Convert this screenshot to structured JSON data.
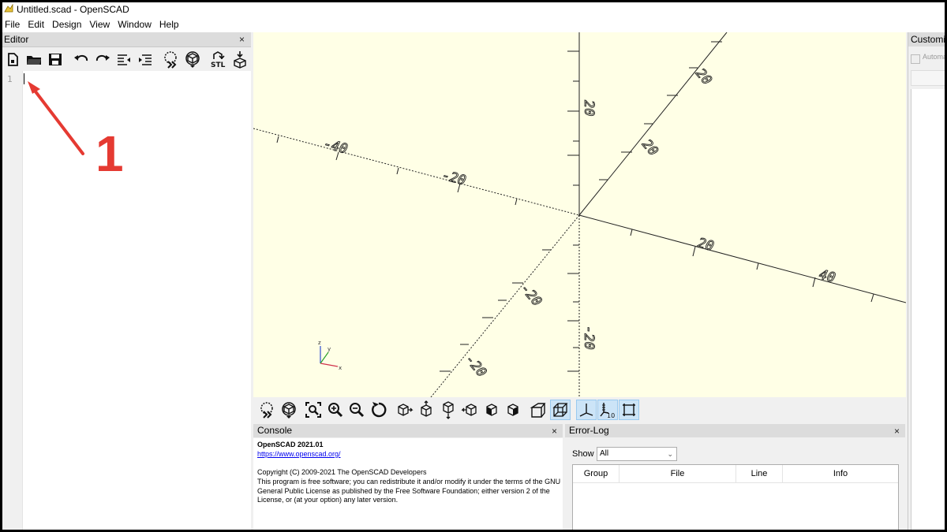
{
  "window": {
    "title": "Untitled.scad - OpenSCAD",
    "icon": "openscad-logo-icon"
  },
  "menu": [
    "File",
    "Edit",
    "Design",
    "View",
    "Window",
    "Help"
  ],
  "editor": {
    "title": "Editor",
    "close": "×",
    "line_number": "1",
    "toolbar_icons": [
      "new-file-icon",
      "open-folder-icon",
      "save-icon",
      "undo-icon",
      "redo-icon",
      "unindent-icon",
      "indent-icon",
      "preview-icon",
      "render-icon",
      "export-stl-icon",
      "send-to-print-icon"
    ],
    "stl_label": "STL"
  },
  "annotation": {
    "number": "1",
    "color": "#e53a32"
  },
  "viewport": {
    "background": "#ffffe6",
    "axis_labels": [
      "-40",
      "-20",
      "20",
      "40",
      "20",
      "-20",
      "20",
      "-20",
      "-20",
      "20"
    ],
    "axes_gizmo": {
      "x": "x",
      "y": "y",
      "z": "z"
    }
  },
  "view_toolbar": {
    "icons": [
      "preview-icon",
      "render-icon",
      "view-all-icon",
      "zoom-in-icon",
      "zoom-out-icon",
      "reset-view-icon",
      "right-view-icon",
      "top-view-icon",
      "bottom-view-icon",
      "left-view-icon",
      "front-view-icon",
      "back-view-icon",
      "perspective-icon",
      "orthogonal-icon",
      "show-axes-icon",
      "show-scale-markers-icon",
      "show-edges-icon"
    ],
    "active": [
      "orthogonal-icon",
      "show-axes-icon",
      "show-scale-markers-icon",
      "show-edges-icon"
    ],
    "scale_label": "10"
  },
  "console": {
    "title": "Console",
    "close": "×",
    "version": "OpenSCAD 2021.01",
    "link": "https://www.openscad.org/",
    "copyright": "Copyright (C) 2009-2021 The OpenSCAD Developers",
    "license": "This program is free software; you can redistribute it and/or modify it under the terms of the GNU General Public License as published by the Free Software Foundation; either version 2 of the License, or (at your option) any later version."
  },
  "error_log": {
    "title": "Error-Log",
    "close": "×",
    "show_label": "Show",
    "show_value": "All",
    "columns": [
      "Group",
      "File",
      "Line",
      "Info"
    ]
  },
  "customizer": {
    "title": "Customiz",
    "auto_label": "Automa"
  }
}
